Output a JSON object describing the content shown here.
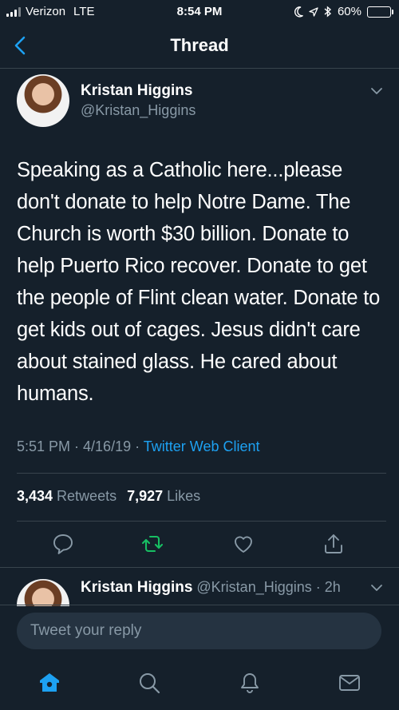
{
  "status_bar": {
    "carrier": "Verizon",
    "network": "LTE",
    "time": "8:54 PM",
    "battery": "60%",
    "battery_level": 0.6
  },
  "nav": {
    "title": "Thread"
  },
  "tweet": {
    "author_name": "Kristan Higgins",
    "author_handle": "@Kristan_Higgins",
    "text": "Speaking as a Catholic here...please don't donate to help Notre Dame. The Church is worth $30 billion. Donate to help Puerto Rico recover. Donate to get the people of Flint clean water. Donate to get kids out of cages. Jesus didn't care about stained glass. He cared about humans.",
    "timestamp": "5:51 PM · 4/16/19 · ",
    "client": "Twitter Web Client",
    "retweets_count": "3,434",
    "retweets_label": " Retweets",
    "likes_count": "7,927",
    "likes_label": " Likes"
  },
  "reply_preview": {
    "author_name": "Kristan Higgins",
    "meta": " @Kristan_Higgins · 2h"
  },
  "reply_bar": {
    "placeholder": "Tweet your reply"
  },
  "colors": {
    "background": "#15202b",
    "accent": "#1da1f2",
    "retweet": "#17bf63",
    "muted": "#8899a6"
  },
  "tabs": [
    {
      "icon": "home-icon"
    },
    {
      "icon": "search-icon"
    },
    {
      "icon": "bell-icon"
    },
    {
      "icon": "mail-icon"
    }
  ]
}
